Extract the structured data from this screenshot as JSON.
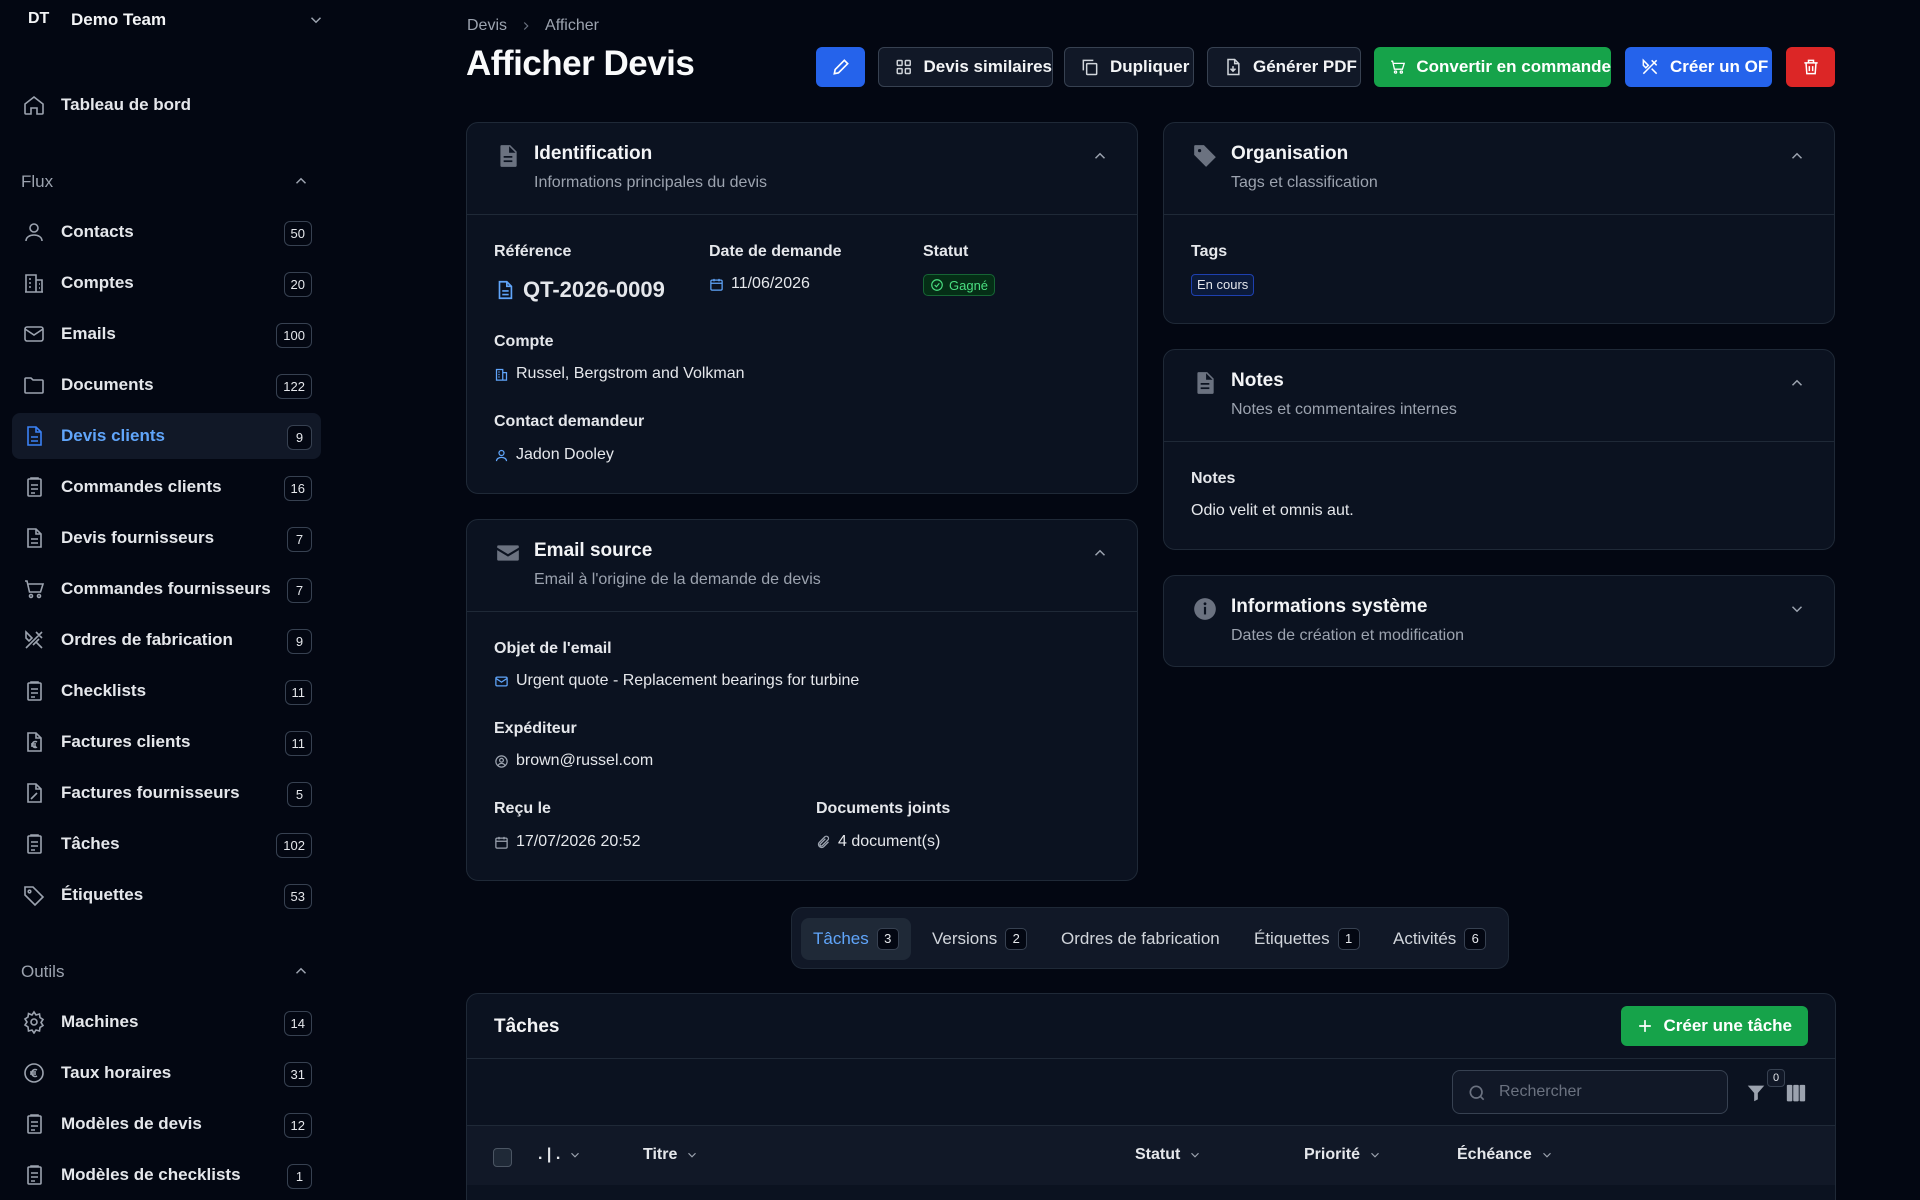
{
  "team": {
    "initials": "DT",
    "name": "Demo Team"
  },
  "sidebar": {
    "dashboard": {
      "label": "Tableau de bord",
      "icon": "home-icon"
    },
    "flux": {
      "title": "Flux",
      "items": [
        {
          "label": "Contacts",
          "count": "50",
          "icon": "user-icon"
        },
        {
          "label": "Comptes",
          "count": "20",
          "icon": "building-icon"
        },
        {
          "label": "Emails",
          "count": "100",
          "icon": "mail-icon"
        },
        {
          "label": "Documents",
          "count": "122",
          "icon": "folder-icon"
        },
        {
          "label": "Devis clients",
          "count": "9",
          "icon": "document-icon"
        },
        {
          "label": "Commandes clients",
          "count": "16",
          "icon": "clipboard-icon"
        },
        {
          "label": "Devis fournisseurs",
          "count": "7",
          "icon": "document-icon"
        },
        {
          "label": "Commandes fournisseurs",
          "count": "7",
          "icon": "cart-icon"
        },
        {
          "label": "Ordres de fabrication",
          "count": "9",
          "icon": "tools-icon"
        },
        {
          "label": "Checklists",
          "count": "11",
          "icon": "clipboard-icon"
        },
        {
          "label": "Factures clients",
          "count": "11",
          "icon": "euro-document-icon"
        },
        {
          "label": "Factures fournisseurs",
          "count": "5",
          "icon": "percent-document-icon"
        },
        {
          "label": "Tâches",
          "count": "102",
          "icon": "clipboard-icon"
        },
        {
          "label": "Étiquettes",
          "count": "53",
          "icon": "tag-icon"
        }
      ]
    },
    "outils": {
      "title": "Outils",
      "items": [
        {
          "label": "Machines",
          "count": "14",
          "icon": "gear-icon"
        },
        {
          "label": "Taux horaires",
          "count": "31",
          "icon": "euro-icon"
        },
        {
          "label": "Modèles de devis",
          "count": "12",
          "icon": "clipboard-icon"
        },
        {
          "label": "Modèles de checklists",
          "count": "1",
          "icon": "clipboard-icon"
        }
      ]
    }
  },
  "breadcrumb": {
    "parent": "Devis",
    "current": "Afficher"
  },
  "page_title": "Afficher Devis",
  "toolbar": {
    "similar": "Devis similaires",
    "duplicate": "Dupliquer",
    "pdf": "Générer PDF",
    "convert": "Convertir en commande",
    "create_of": "Créer un OF"
  },
  "identification": {
    "title": "Identification",
    "subtitle": "Informations principales du devis",
    "reference_label": "Référence",
    "reference": "QT-2026-0009",
    "date_label": "Date de demande",
    "date": "11/06/2026",
    "status_label": "Statut",
    "status": "Gagné",
    "account_label": "Compte",
    "account": "Russel, Bergstrom and Volkman",
    "contact_label": "Contact demandeur",
    "contact": "Jadon Dooley"
  },
  "email_source": {
    "title": "Email source",
    "subtitle": "Email à l'origine de la demande de devis",
    "subject_label": "Objet de l'email",
    "subject": "Urgent quote - Replacement bearings for turbine",
    "sender_label": "Expéditeur",
    "sender": "brown@russel.com",
    "received_label": "Reçu le",
    "received": "17/07/2026 20:52",
    "attachments_label": "Documents joints",
    "attachments": "4 document(s)"
  },
  "organisation": {
    "title": "Organisation",
    "subtitle": "Tags et classification",
    "tags_label": "Tags",
    "tag": "En cours"
  },
  "notes": {
    "title": "Notes",
    "subtitle": "Notes et commentaires internes",
    "label": "Notes",
    "value": "Odio velit et omnis aut."
  },
  "system": {
    "title": "Informations système",
    "subtitle": "Dates de création et modification"
  },
  "tabs": [
    {
      "label": "Tâches",
      "count": "3"
    },
    {
      "label": "Versions",
      "count": "2"
    },
    {
      "label": "Ordres de fabrication",
      "count": ""
    },
    {
      "label": "Étiquettes",
      "count": "1"
    },
    {
      "label": "Activités",
      "count": "6"
    }
  ],
  "tasks": {
    "title": "Tâches",
    "create_label": "Créer une tâche",
    "search_placeholder": "Rechercher",
    "filter_count": "0",
    "columns": [
      ". | .",
      "Titre",
      "Statut",
      "Priorité",
      "Échéance"
    ]
  },
  "colors": {
    "primary": "#2563eb",
    "success": "#16a34a",
    "danger": "#dc2626",
    "background": "#030712",
    "card": "#0b1220"
  }
}
